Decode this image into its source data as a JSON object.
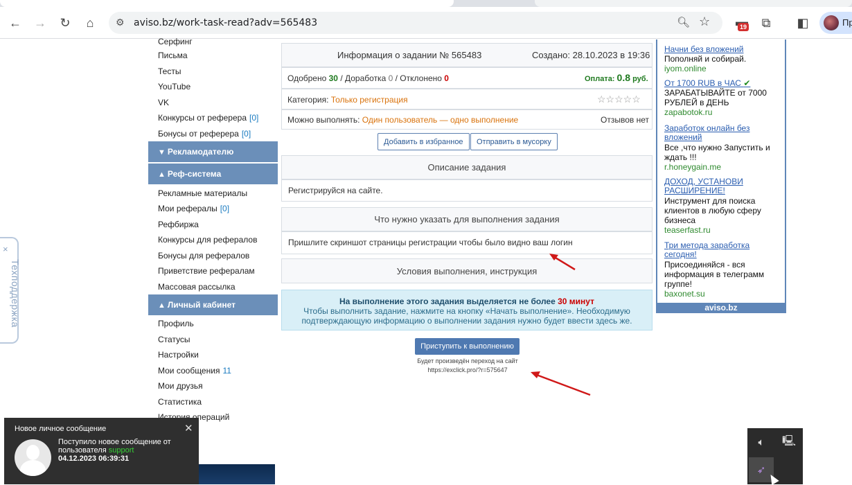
{
  "browser": {
    "url": "aviso.bz/work-task-read?adv=565483",
    "ext_badge": "19",
    "profile_label": "Пр",
    "icons": [
      "back-icon",
      "forward-icon",
      "reload-icon",
      "home-icon",
      "site-info-icon",
      "zoom-icon",
      "star-icon",
      "extension-icon",
      "puzzle-icon",
      "sidebar-icon"
    ]
  },
  "menu": {
    "items_top": [
      {
        "label": "Серфинг"
      },
      {
        "label": "Письма"
      },
      {
        "label": "Тесты"
      },
      {
        "label": "YouTube"
      },
      {
        "label": "VK"
      },
      {
        "label": "Конкурсы от реферера",
        "count": "[0]"
      },
      {
        "label": "Бонусы от реферера",
        "count": "[0]"
      }
    ],
    "section_advertiser": "Рекламодателю",
    "section_ref": "Реф-система",
    "items_ref": [
      {
        "label": "Рекламные материалы"
      },
      {
        "label": "Мои рефералы",
        "count": "[0]"
      },
      {
        "label": "Рефбиржа"
      },
      {
        "label": "Конкурсы для рефералов"
      },
      {
        "label": "Бонусы для рефералов"
      },
      {
        "label": "Приветствие рефералам"
      },
      {
        "label": "Массовая рассылка"
      }
    ],
    "section_cabinet": "Личный кабинет",
    "items_cabinet": [
      {
        "label": "Профиль"
      },
      {
        "label": "Статусы"
      },
      {
        "label": "Настройки"
      },
      {
        "label": "Мои сообщения",
        "count": "11"
      },
      {
        "label": "Мои друзья"
      },
      {
        "label": "Статистика"
      },
      {
        "label": "История операций"
      }
    ]
  },
  "task": {
    "title": "Информация о задании № 565483",
    "created": "Создано: 28.10.2023 в 19:36",
    "approved_label": "Одобрено",
    "approved": "30",
    "rework_label": "/ Доработка",
    "rework": "0",
    "rejected_label": "/ Отклонено",
    "rejected": "0",
    "payment_label": "Оплата:",
    "payment_value": "0.8",
    "payment_unit": "руб.",
    "category_label": "Категория:",
    "category": "Только регистрация",
    "can_do_label": "Можно выполнять:",
    "can_do": "Один пользователь — одно выполнение",
    "reviews": "Отзывов нет",
    "add_fav_btn": "Добавить в избранное",
    "trash_btn": "Отправить в мусорку",
    "desc_header": "Описание задания",
    "desc_text": "Регистрируйся на сайте.",
    "need_header": "Что нужно указать для выполнения задания",
    "need_text": "Пришлите скриншот страницы регистрации чтобы было видно ваш логин",
    "cond_header": "Условия выполнения, инструкция",
    "time_text_a": "На выполнение этого задания выделяется не более",
    "time_value": "30 минут",
    "info_line2": "Чтобы выполнить задание, нажмите на кнопку «Начать выполнение». Необходимую",
    "info_line3": "подтверждающую информацию о выполнении задания нужно будет ввести здесь же.",
    "start_btn": "Приступить к выполнению",
    "redirect_line1": "Будет произведён переход на сайт",
    "redirect_line2": "https://exclick.pro/?r=575647"
  },
  "ads": [
    {
      "link": "Начни без вложений",
      "text": "Пополняй и собирай.",
      "domain": "iyom.online"
    },
    {
      "link": "От 1700 RUB в ЧАС",
      "text": "ЗАРАБАТЫВАЙТЕ от 7000 РУБЛЕЙ в ДЕНЬ",
      "domain": "zapabotok.ru"
    },
    {
      "link": "Заработок онлайн без вложений",
      "text": "Все ,что нужно Запустить и ждать !!!",
      "domain": "r.honeygain.me"
    },
    {
      "link": "ДОХОД, УСТАНОВИ РАСШИРЕНИЕ!",
      "text": "Инструмент для поиска клиентов в любую сферу бизнеса",
      "domain": "teaserfast.ru"
    },
    {
      "link": "Три метода заработка сегодня!",
      "text": "Присоединяйся - вся информация в телеграмм группе!",
      "domain": "baxonet.su"
    }
  ],
  "ads_footer": "aviso.bz",
  "support": {
    "label": "Техподдержка",
    "close": "×"
  },
  "notification": {
    "title": "Новое личное сообщение",
    "line1": "Поступило новое сообщение от",
    "line2": "пользователя",
    "user": "support",
    "date": "04.12.2023 06:39:31",
    "close": "✕"
  },
  "colors": {
    "menu_section": "#6b8fb9",
    "info_bg": "#d9eff7",
    "accent_green": "#1f7a1f",
    "accent_red": "#c00000",
    "arrow": "#d01818"
  }
}
